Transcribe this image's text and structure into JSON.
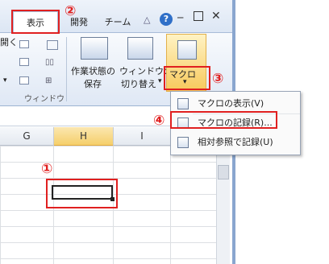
{
  "ribbon": {
    "tabs": [
      {
        "label": "表示"
      },
      {
        "label": "開発"
      },
      {
        "label": "チーム"
      }
    ],
    "left_items": {
      "open_label": "開く"
    },
    "group_window_label": "ウィンドウ",
    "save_workspace_label_1": "作業状態の",
    "save_workspace_label_2": "保存",
    "switch_window_label_1": "ウィンドウの",
    "switch_window_label_2": "切り替え",
    "macro_label": "マクロ"
  },
  "sheet": {
    "columns": [
      "G",
      "H",
      "I"
    ],
    "selected_column": "H"
  },
  "menu": {
    "items": [
      {
        "label": "マクロの表示(V)"
      },
      {
        "label": "マクロの記録(R)..."
      },
      {
        "label": "相対参照で記録(U)"
      }
    ]
  },
  "annotations": {
    "n1": "①",
    "n2": "②",
    "n3": "③",
    "n4": "④"
  },
  "colors": {
    "annotation": "#e02020",
    "selected_header": "#f5cf6b"
  }
}
